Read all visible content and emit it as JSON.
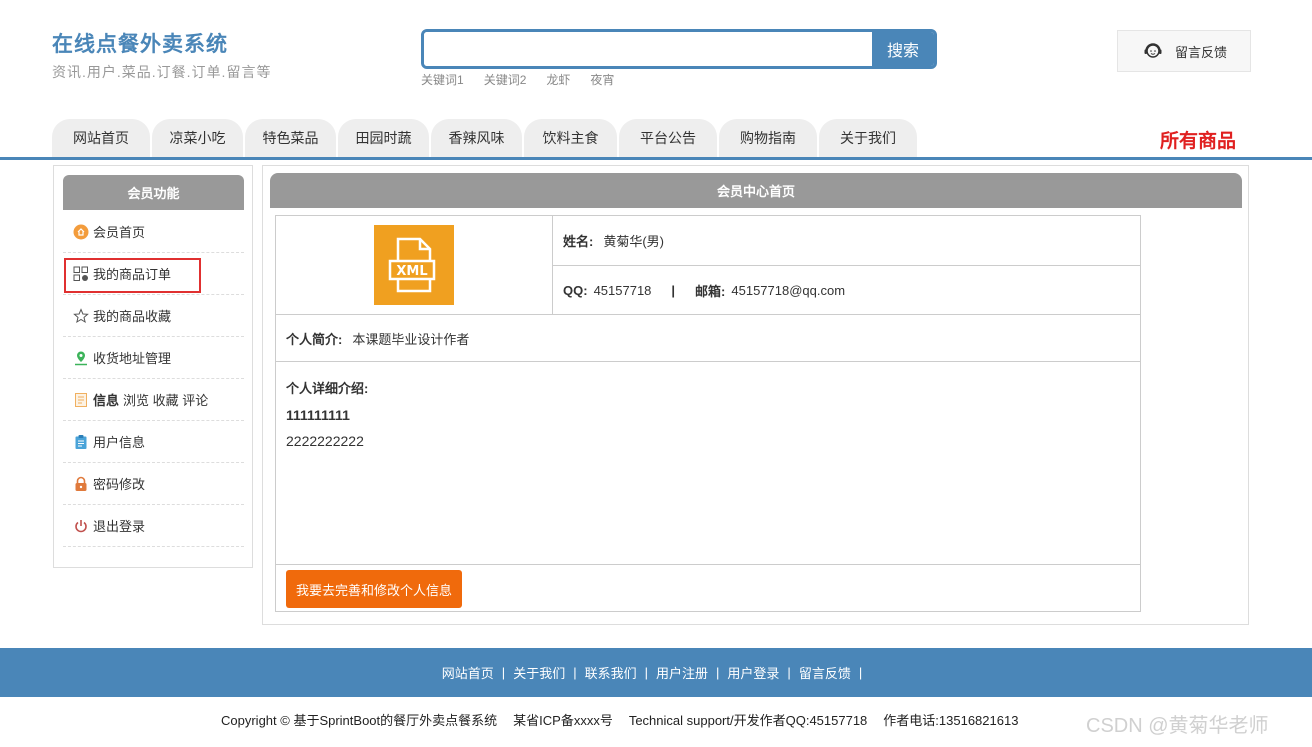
{
  "header": {
    "title": "在线点餐外卖系统",
    "subtitle": "资讯.用户.菜品.订餐.订单.留言等",
    "search_button": "搜索",
    "search_value": "",
    "keywords": [
      "关键词1",
      "关键词2",
      "龙虾",
      "夜宵"
    ],
    "feedback_label": "留言反馈"
  },
  "nav": {
    "items": [
      "网站首页",
      "凉菜小吃",
      "特色菜品",
      "田园时蔬",
      "香辣风味",
      "饮料主食",
      "平台公告",
      "购物指南",
      "关于我们"
    ],
    "all_goods": "所有商品"
  },
  "sidebar": {
    "title": "会员功能",
    "items": [
      {
        "label": "会员首页",
        "icon": "home-circle-icon"
      },
      {
        "label": "我的商品订单",
        "icon": "order-grid-icon",
        "highlighted": true
      },
      {
        "label": "我的商品收藏",
        "icon": "star-icon"
      },
      {
        "label": "收货地址管理",
        "icon": "location-pin-icon"
      },
      {
        "label_bold": "信息",
        "label": "浏览 收藏 评论",
        "icon": "document-icon"
      },
      {
        "label": "用户信息",
        "icon": "clipboard-icon"
      },
      {
        "label": "密码修改",
        "icon": "lock-icon"
      },
      {
        "label": "退出登录",
        "icon": "power-icon"
      }
    ]
  },
  "main": {
    "title": "会员中心首页",
    "avatar_text": "XML",
    "name_label": "姓名:",
    "name_value": "黄菊华(男)",
    "qq_label": "QQ:",
    "qq_value": "45157718",
    "separator": "|",
    "email_label": "邮箱:",
    "email_value": "45157718@qq.com",
    "brief_label": "个人简介:",
    "brief_value": "本课题毕业设计作者",
    "detail_label": "个人详细介绍:",
    "detail_line1": "111111111",
    "detail_line2": "2222222222",
    "edit_button": "我要去完善和修改个人信息"
  },
  "footer": {
    "links": [
      "网站首页",
      "关于我们",
      "联系我们",
      "用户注册",
      "用户登录",
      "留言反馈"
    ],
    "copyright": "Copyright © 基于SprintBoot的餐厅外卖点餐系统",
    "icp": "某省ICP备xxxx号",
    "support": "Technical support/开发作者QQ:45157718",
    "phone": "作者电话:13516821613",
    "watermark": "CSDN @黄菊华老师"
  },
  "colors": {
    "brand_blue": "#4a86b8",
    "accent_orange": "#f06a0c",
    "red": "#e02020",
    "header_grey": "#999999"
  }
}
